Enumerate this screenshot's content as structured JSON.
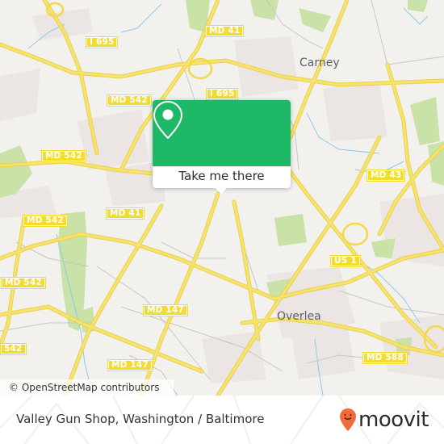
{
  "map": {
    "route_shields": [
      {
        "id": "i695-top",
        "label": "I 695"
      },
      {
        "id": "md41-top",
        "label": "MD 41"
      },
      {
        "id": "md542-a",
        "label": "MD 542"
      },
      {
        "id": "i695-mid",
        "label": "I 695"
      },
      {
        "id": "md542-b",
        "label": "MD 542"
      },
      {
        "id": "md43",
        "label": "MD 43"
      },
      {
        "id": "md542-c",
        "label": "MD 542"
      },
      {
        "id": "md41-mid",
        "label": "MD 41"
      },
      {
        "id": "us1",
        "label": "US 1"
      },
      {
        "id": "md542-d",
        "label": "MD 542"
      },
      {
        "id": "md147-a",
        "label": "MD 147"
      },
      {
        "id": "md542-e",
        "label": "542"
      },
      {
        "id": "md588",
        "label": "MD 588"
      },
      {
        "id": "md147-b",
        "label": "MD 147"
      }
    ],
    "places": [
      {
        "id": "carney",
        "label": "Carney"
      },
      {
        "id": "overlea",
        "label": "Overlea"
      }
    ],
    "attribution": "© OpenStreetMap contributors",
    "colors": {
      "road": "#f7e26b",
      "road_casing": "#e8cf4a",
      "park": "#c9e2a8",
      "water": "#8ec9ea",
      "urban": "#ebe6e4",
      "background": "#f2f1ee"
    }
  },
  "popup": {
    "icon": "map-pin-icon",
    "action_label": "Take me there",
    "accent_color": "#1fb866"
  },
  "footer": {
    "title": "Valley Gun Shop, Washington / Baltimore",
    "brand": "moovit",
    "brand_color": "#f26b3a"
  }
}
